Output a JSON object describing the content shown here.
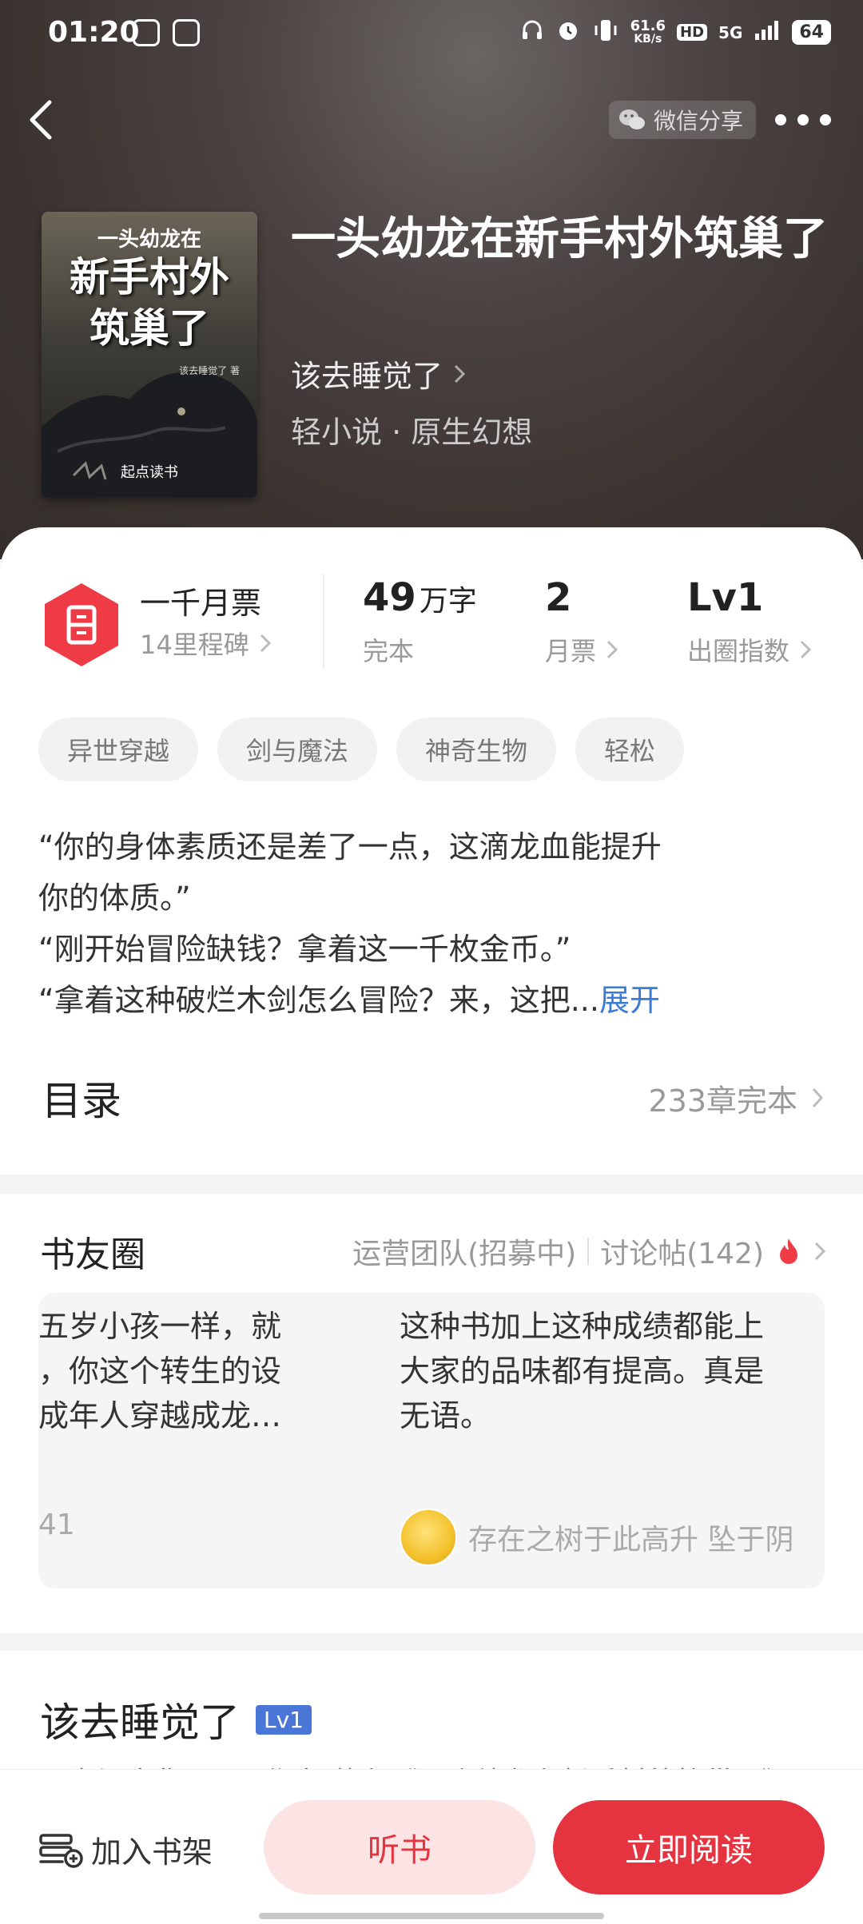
{
  "status_bar": {
    "time": "01:20",
    "speed": "61.6",
    "speed_unit": "KB/s",
    "hd": "HD",
    "network": "5G",
    "battery": "64"
  },
  "header": {
    "share_label": "微信分享"
  },
  "book": {
    "cover_line1": "一头幼龙在",
    "cover_line2": "新手村外",
    "cover_line3": "筑巢了",
    "cover_author": "该去睡觉了 著",
    "cover_publisher": "起点读书",
    "title": "一头幼龙在新手村外筑巢了",
    "author": "该去睡觉了",
    "genre": "轻小说 · 原生幻想"
  },
  "stats": {
    "monthly_ticket_title": "一千月票",
    "monthly_ticket_sub": "14里程碑",
    "words_value": "49",
    "words_unit": "万字",
    "words_label": "完本",
    "tickets_value": "2",
    "tickets_label": "月票",
    "level_value": "Lv1",
    "level_label": "出圈指数"
  },
  "tags": [
    "异世穿越",
    "剑与魔法",
    "神奇生物",
    "轻松"
  ],
  "intro": {
    "line1": "“你的身体素质还是差了一点，这滴龙血能提升",
    "line2": "你的体质。”",
    "line3": "“刚开始冒险缺钱？拿着这一千枚金币。”",
    "line4": "“拿着这种破烂木剑怎么冒险？来，这把...",
    "expand": "展开"
  },
  "toc": {
    "title": "目录",
    "summary": "233章完本"
  },
  "circle": {
    "title": "书友圈",
    "team": "运营团队(招募中)",
    "discussions": "讨论帖(142)",
    "post1_line1": "五岁小孩一样，就",
    "post1_line2": "，你这个转生的设",
    "post1_line3": "成年人穿越成龙…",
    "post1_count": "41",
    "post2_line1": "这种书加上这种成绩都能上",
    "post2_line2": "大家的品味都有提高。真是",
    "post2_line3": "无语。",
    "post2_user": "存在之树于此高升 坠于阴"
  },
  "author_section": {
    "name": "该去睡觉了",
    "level": "Lv1",
    "desc": "现为阅文集团Lv1作家 著有《一头幼龙在新手村外筑巢了》"
  },
  "bottom_bar": {
    "shelf": "加入书架",
    "listen": "听书",
    "read": "立即阅读"
  },
  "colors": {
    "accent": "#e5333f",
    "link": "#3a7bd5",
    "level_badge": "#4a76d8"
  }
}
